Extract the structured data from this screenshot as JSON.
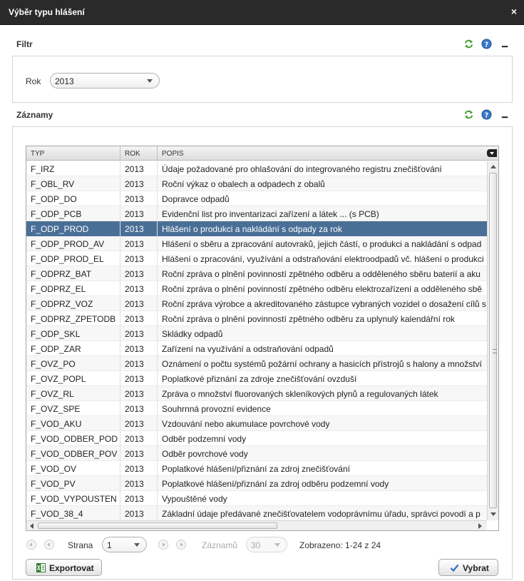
{
  "window": {
    "title": "Výběr typu hlášení",
    "close": "×"
  },
  "filter": {
    "title": "Filtr",
    "rok_label": "Rok",
    "rok_value": "2013"
  },
  "records": {
    "title": "Záznamy"
  },
  "grid": {
    "columns": [
      "TYP",
      "ROK",
      "POPIS"
    ],
    "selected_index": 4,
    "rows": [
      [
        "F_IRZ",
        "2013",
        "Údaje požadované pro ohlašování do integrovaného registru znečišťování"
      ],
      [
        "F_OBL_RV",
        "2013",
        "Roční výkaz o obalech a odpadech z obalů"
      ],
      [
        "F_ODP_DO",
        "2013",
        "Dopravce odpadů"
      ],
      [
        "F_ODP_PCB",
        "2013",
        "Evidenční list pro inventarizaci zařízení a látek ... (s PCB)"
      ],
      [
        "F_ODP_PROD",
        "2013",
        "Hlášení o produkci a nakládání s odpady za rok"
      ],
      [
        "F_ODP_PROD_AV",
        "2013",
        "Hlášení o sběru a zpracování autovraků, jejich částí, o produkci a nakládání s odpad"
      ],
      [
        "F_ODP_PROD_EL",
        "2013",
        "Hlášení o zpracování, využívání a odstraňování elektroodpadů vč. hlášení o produkci"
      ],
      [
        "F_ODPRZ_BAT",
        "2013",
        "Roční zpráva o plnění povinností zpětného odběru a odděleného sběru baterií a aku"
      ],
      [
        "F_ODPRZ_EL",
        "2013",
        "Roční zpráva o plnění povinností zpětného odběru elektrozařízení a odděleného sbě"
      ],
      [
        "F_ODPRZ_VOZ",
        "2013",
        "Roční zpráva výrobce a akreditovaného zástupce vybraných vozidel o dosažení cílů s"
      ],
      [
        "F_ODPRZ_ZPETODB",
        "2013",
        "Roční zpráva o plnění povinností zpětného odběru za uplynulý kalendářní rok"
      ],
      [
        "F_ODP_SKL",
        "2013",
        "Skládky odpadů"
      ],
      [
        "F_ODP_ZAR",
        "2013",
        "Zařízení na využívání a odstraňování odpadů"
      ],
      [
        "F_OVZ_PO",
        "2013",
        "Oznámení o počtu systémů požární ochrany a hasicích přístrojů s halony a množství"
      ],
      [
        "F_OVZ_POPL",
        "2013",
        "Poplatkové přiznání za zdroje znečišťování ovzduší"
      ],
      [
        "F_OVZ_RL",
        "2013",
        "Zpráva o množství fluorovaných skleníkových plynů a regulovaných látek"
      ],
      [
        "F_OVZ_SPE",
        "2013",
        "Souhrnná provozní evidence"
      ],
      [
        "F_VOD_AKU",
        "2013",
        "Vzdouvání nebo akumulace povrchové vody"
      ],
      [
        "F_VOD_ODBER_POD",
        "2013",
        "Odběr podzemní vody"
      ],
      [
        "F_VOD_ODBER_POV",
        "2013",
        "Odběr povrchové vody"
      ],
      [
        "F_VOD_OV",
        "2013",
        "Poplatkové hlášení/přiznání za zdroj znečišťování"
      ],
      [
        "F_VOD_PV",
        "2013",
        "Poplatkové hlášení/přiznání za zdroj odběru podzemní vody"
      ],
      [
        "F_VOD_VYPOUSTEN",
        "2013",
        "Vypouštěné vody"
      ],
      [
        "F_VOD_38_4",
        "2013",
        "Základní údaje předávané znečišťovatelem vodoprávnímu úřadu, správci povodí a p"
      ]
    ]
  },
  "pager": {
    "page_label": "Strana",
    "page_value": "1",
    "records_label": "Záznamů",
    "records_value": "30",
    "displayed": "Zobrazeno: 1-24 z 24"
  },
  "buttons": {
    "export": "Exportovat",
    "select": "Vybrat"
  },
  "icons": {
    "refresh": "refresh-icon",
    "help": "help-icon",
    "minimize": "minimize-icon",
    "excel": "excel-icon",
    "check": "check-icon"
  },
  "colors": {
    "titlebar": "#2a2a2a",
    "selected_row": "#4a6f97",
    "refresh_green": "#3f9a2a",
    "help_blue": "#3a78c8"
  }
}
